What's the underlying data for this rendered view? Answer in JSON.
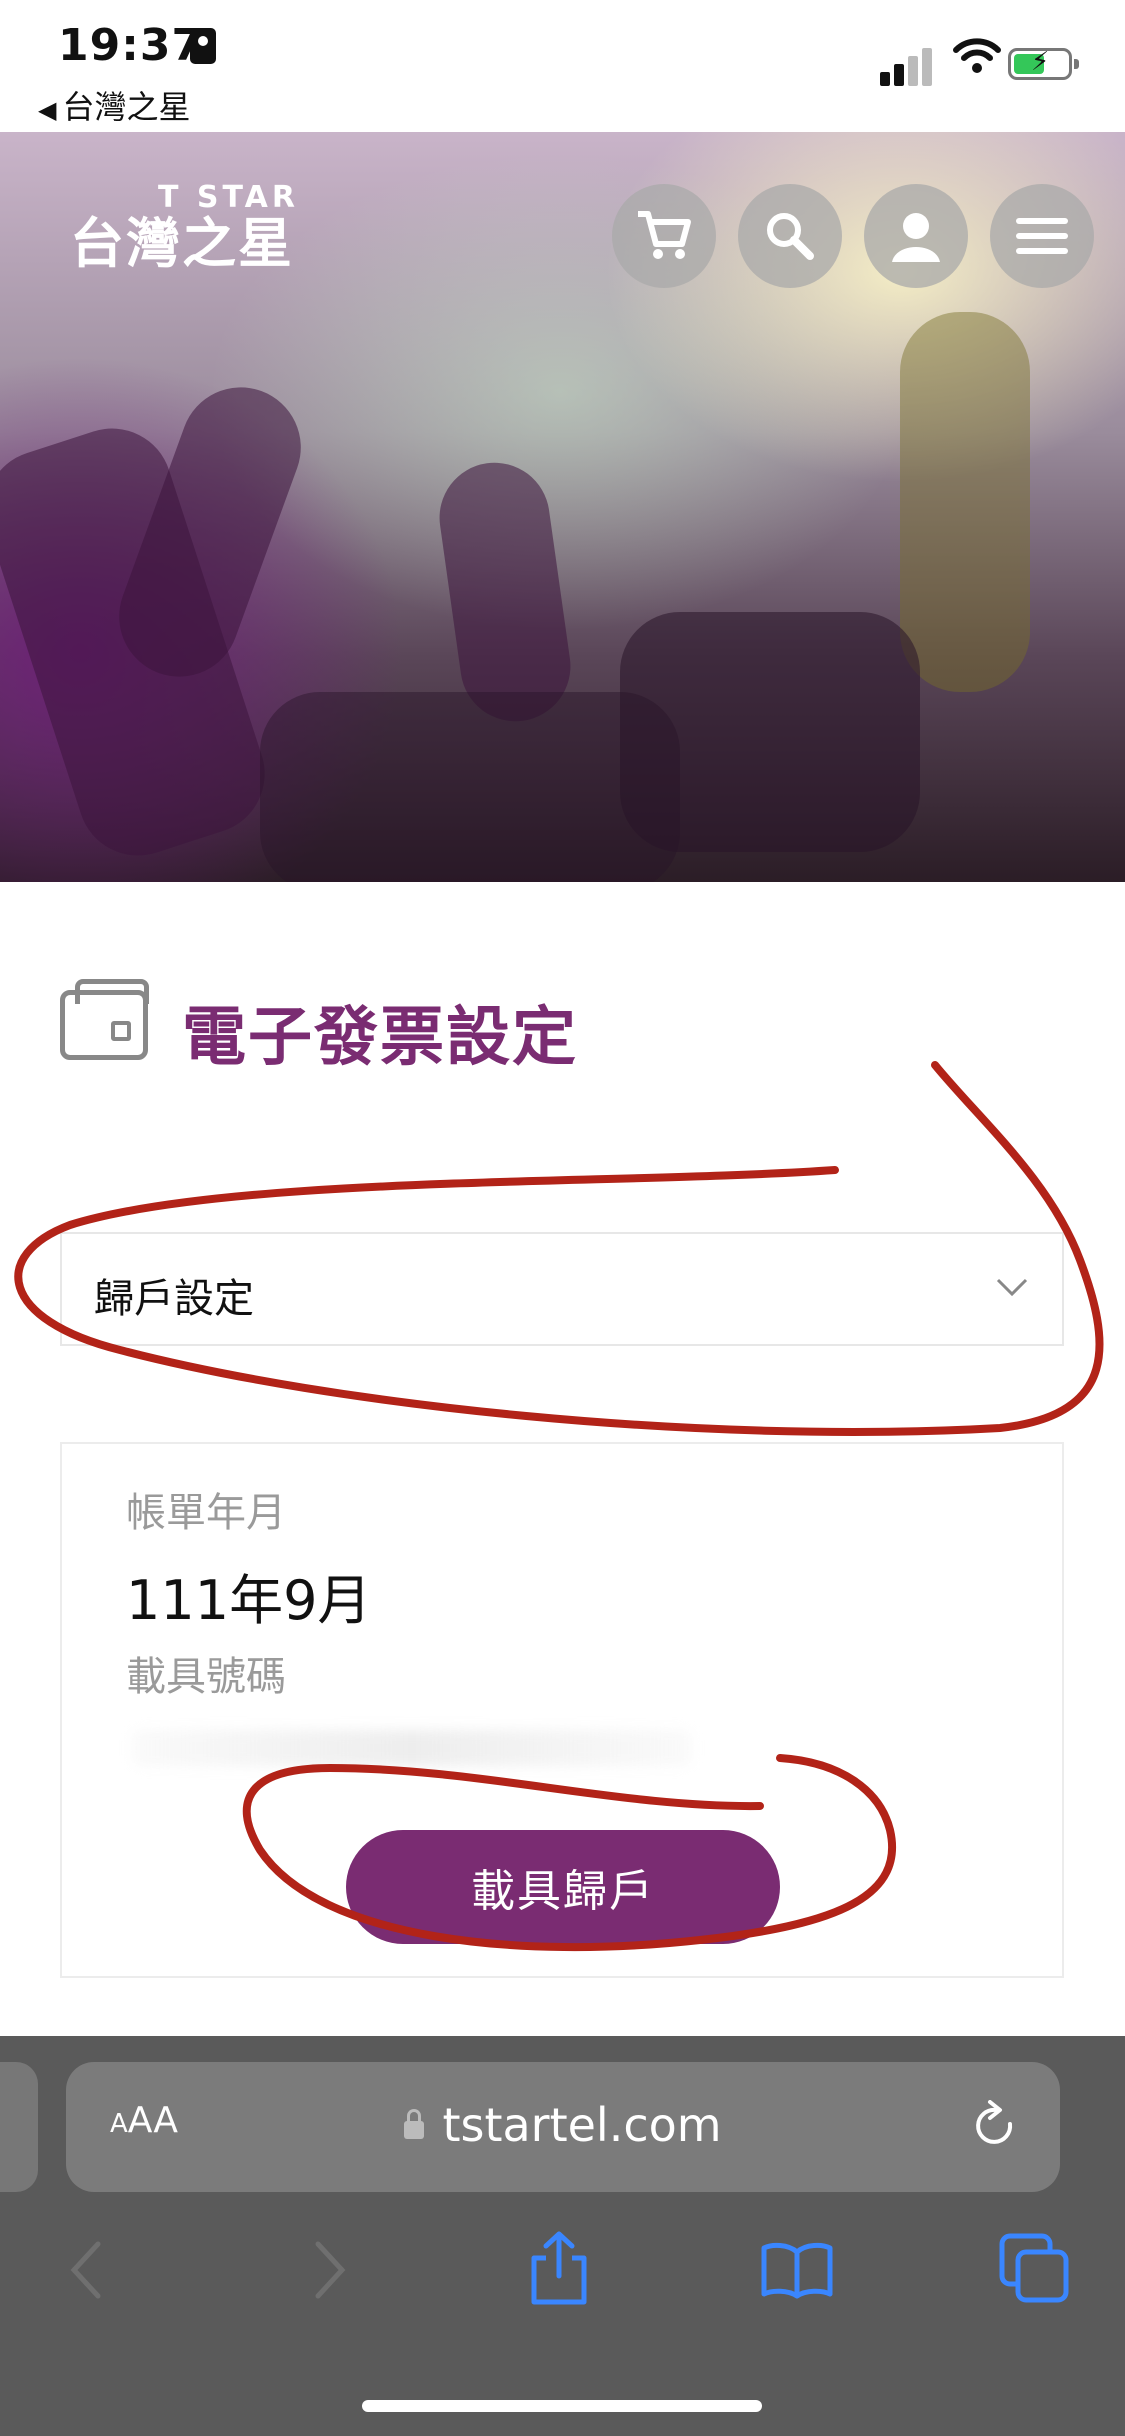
{
  "status_bar": {
    "time": "19:37",
    "back_app": "台灣之星"
  },
  "header": {
    "brand_en": "T STAR",
    "brand_zh": "台灣之星",
    "icons": [
      "cart-icon",
      "search-icon",
      "user-icon",
      "menu-icon"
    ]
  },
  "page": {
    "title": "電子發票設定",
    "select_value": "歸戶設定",
    "card": {
      "billing_label": "帳單年月",
      "billing_value": "111年9月",
      "carrier_label": "載具號碼",
      "button_label": "載具歸戶"
    }
  },
  "browser": {
    "text_size_label": "AA",
    "url": "tstartel.com"
  },
  "colors": {
    "brand_purple": "#7a2c72",
    "annotation_red": "#b22318",
    "toolbar_blue": "#3a86ff"
  }
}
